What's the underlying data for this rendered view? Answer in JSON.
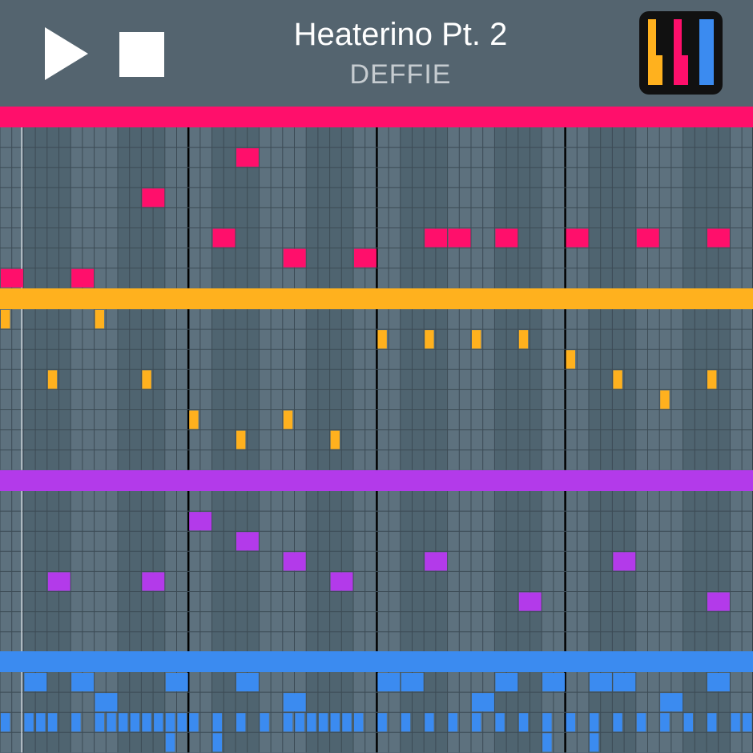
{
  "header": {
    "title": "Heaterino Pt. 2",
    "artist": "DEFFIE"
  },
  "controls": {
    "play_icon": "play-icon",
    "stop_icon": "stop-icon",
    "logo_icon": "piano-keys-icon"
  },
  "colors": {
    "header_bg": "#54646f",
    "cell_light": "#5d717e",
    "cell_dark": "#4f6470",
    "grid_line": "#3c4b55",
    "bar_line": "#000000",
    "playhead": "#c9d1d6",
    "logo_keys": [
      "#ffb11e",
      "#ff0f6b",
      "#3b8bf0"
    ]
  },
  "sequencer": {
    "steps": 64,
    "tracks": [
      {
        "name": "pink",
        "color": "#ff0f6b",
        "rows": 8,
        "notes": [
          {
            "step": 20,
            "row": 1
          },
          {
            "step": 12,
            "row": 3
          },
          {
            "step": 18,
            "row": 5
          },
          {
            "step": 36,
            "row": 5
          },
          {
            "step": 38,
            "row": 5
          },
          {
            "step": 42,
            "row": 5
          },
          {
            "step": 48,
            "row": 5
          },
          {
            "step": 54,
            "row": 5
          },
          {
            "step": 60,
            "row": 5
          },
          {
            "step": 24,
            "row": 6
          },
          {
            "step": 30,
            "row": 6
          },
          {
            "step": 0,
            "row": 7
          },
          {
            "step": 6,
            "row": 7
          }
        ]
      },
      {
        "name": "orange",
        "color": "#ffb11e",
        "rows": 8,
        "notes": [
          {
            "step": 0,
            "row": 0
          },
          {
            "step": 8,
            "row": 0
          },
          {
            "step": 32,
            "row": 1
          },
          {
            "step": 36,
            "row": 1
          },
          {
            "step": 40,
            "row": 1
          },
          {
            "step": 44,
            "row": 1
          },
          {
            "step": 48,
            "row": 2
          },
          {
            "step": 4,
            "row": 3
          },
          {
            "step": 12,
            "row": 3
          },
          {
            "step": 52,
            "row": 3
          },
          {
            "step": 60,
            "row": 3
          },
          {
            "step": 56,
            "row": 4
          },
          {
            "step": 16,
            "row": 5
          },
          {
            "step": 24,
            "row": 5
          },
          {
            "step": 20,
            "row": 6
          },
          {
            "step": 28,
            "row": 6
          }
        ]
      },
      {
        "name": "purple",
        "color": "#b33aea",
        "rows": 8,
        "notes": [
          {
            "step": 16,
            "row": 1
          },
          {
            "step": 20,
            "row": 2
          },
          {
            "step": 24,
            "row": 3
          },
          {
            "step": 36,
            "row": 3
          },
          {
            "step": 52,
            "row": 3
          },
          {
            "step": 4,
            "row": 4
          },
          {
            "step": 12,
            "row": 4
          },
          {
            "step": 28,
            "row": 4
          },
          {
            "step": 44,
            "row": 5
          },
          {
            "step": 60,
            "row": 5
          }
        ]
      },
      {
        "name": "blue",
        "color": "#3b8bf0",
        "rows": 4,
        "notes": [
          {
            "step": 2,
            "row": 0
          },
          {
            "step": 6,
            "row": 0
          },
          {
            "step": 14,
            "row": 0
          },
          {
            "step": 20,
            "row": 0
          },
          {
            "step": 32,
            "row": 0
          },
          {
            "step": 34,
            "row": 0
          },
          {
            "step": 42,
            "row": 0
          },
          {
            "step": 46,
            "row": 0
          },
          {
            "step": 50,
            "row": 0
          },
          {
            "step": 52,
            "row": 0
          },
          {
            "step": 60,
            "row": 0
          },
          {
            "step": 8,
            "row": 1
          },
          {
            "step": 24,
            "row": 1
          },
          {
            "step": 40,
            "row": 1
          },
          {
            "step": 56,
            "row": 1
          },
          {
            "step": 0,
            "row": 2
          },
          {
            "step": 2,
            "row": 2
          },
          {
            "step": 3,
            "row": 2
          },
          {
            "step": 4,
            "row": 2
          },
          {
            "step": 6,
            "row": 2
          },
          {
            "step": 8,
            "row": 2
          },
          {
            "step": 9,
            "row": 2
          },
          {
            "step": 10,
            "row": 2
          },
          {
            "step": 11,
            "row": 2
          },
          {
            "step": 12,
            "row": 2
          },
          {
            "step": 13,
            "row": 2
          },
          {
            "step": 14,
            "row": 2
          },
          {
            "step": 15,
            "row": 2
          },
          {
            "step": 16,
            "row": 2
          },
          {
            "step": 18,
            "row": 2
          },
          {
            "step": 20,
            "row": 2
          },
          {
            "step": 22,
            "row": 2
          },
          {
            "step": 24,
            "row": 2
          },
          {
            "step": 25,
            "row": 2
          },
          {
            "step": 26,
            "row": 2
          },
          {
            "step": 27,
            "row": 2
          },
          {
            "step": 28,
            "row": 2
          },
          {
            "step": 29,
            "row": 2
          },
          {
            "step": 30,
            "row": 2
          },
          {
            "step": 32,
            "row": 2
          },
          {
            "step": 34,
            "row": 2
          },
          {
            "step": 36,
            "row": 2
          },
          {
            "step": 38,
            "row": 2
          },
          {
            "step": 40,
            "row": 2
          },
          {
            "step": 42,
            "row": 2
          },
          {
            "step": 44,
            "row": 2
          },
          {
            "step": 46,
            "row": 2
          },
          {
            "step": 48,
            "row": 2
          },
          {
            "step": 50,
            "row": 2
          },
          {
            "step": 52,
            "row": 2
          },
          {
            "step": 54,
            "row": 2
          },
          {
            "step": 56,
            "row": 2
          },
          {
            "step": 58,
            "row": 2
          },
          {
            "step": 60,
            "row": 2
          },
          {
            "step": 62,
            "row": 2
          },
          {
            "step": 63,
            "row": 2
          },
          {
            "step": 14,
            "row": 3
          },
          {
            "step": 18,
            "row": 3
          },
          {
            "step": 46,
            "row": 3
          },
          {
            "step": 50,
            "row": 3
          }
        ]
      }
    ]
  }
}
